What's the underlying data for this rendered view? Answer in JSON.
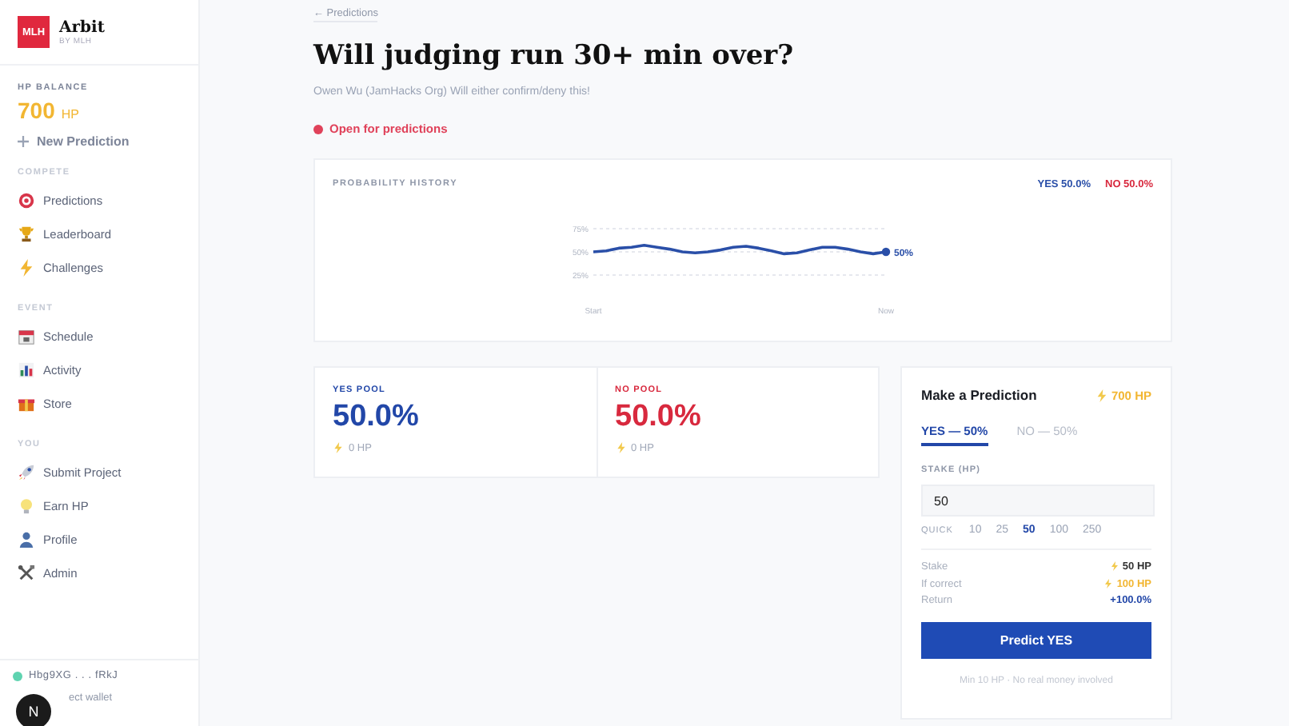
{
  "sidebar": {
    "logo": "MLH",
    "brand": "Arbit",
    "brand_sub": "BY MLH",
    "balance_label": "HP BALANCE",
    "balance_value": "700",
    "balance_unit": "HP",
    "new_prediction": "New Prediction",
    "sections": [
      {
        "title": "COMPETE",
        "items": [
          {
            "label": "Predictions",
            "selected": false
          },
          {
            "label": "Leaderboard",
            "selected": false
          },
          {
            "label": "Challenges",
            "selected": false
          }
        ]
      },
      {
        "title": "EVENT",
        "items": [
          {
            "label": "Schedule",
            "selected": false
          },
          {
            "label": "Activity",
            "selected": false
          },
          {
            "label": "Store",
            "selected": false
          }
        ]
      },
      {
        "title": "YOU",
        "items": [
          {
            "label": "Submit Project",
            "selected": false
          },
          {
            "label": "Earn HP",
            "selected": false
          },
          {
            "label": "Profile",
            "selected": false
          },
          {
            "label": "Admin",
            "selected": false
          }
        ]
      }
    ],
    "wallet": {
      "address": "Hbg9XG . . . fRkJ",
      "connected": true,
      "action": "ect wallet"
    },
    "badge": "N"
  },
  "back_link": "← Predictions",
  "title": "Will judging run 30+ min over?",
  "subtitle": "Owen Wu (JamHacks Org) Will either confirm/deny this!",
  "status": {
    "label": "Open for predictions",
    "color": "#e0425a"
  },
  "history": {
    "title": "PROBABILITY HISTORY",
    "yes": "YES 50.0%",
    "no": "NO 50.0%",
    "end_label": "50%",
    "chart_data": {
      "type": "line",
      "categories": [
        "Start",
        null,
        null,
        null,
        null,
        null,
        null,
        null,
        null,
        null,
        null,
        null,
        null,
        null,
        null,
        null,
        null,
        null,
        null,
        null,
        null,
        null,
        null,
        "Now"
      ],
      "yticks": [
        {
          "value": 25,
          "label": "25%"
        },
        {
          "value": 50,
          "label": "50%"
        },
        {
          "value": 75,
          "label": "75%"
        }
      ],
      "grid": true,
      "ylim": [
        25,
        75
      ],
      "series": [
        {
          "color": "#2a4fa8",
          "values": [
            50,
            51,
            54,
            55,
            57,
            55,
            53,
            50,
            49,
            50,
            52,
            55,
            56,
            54,
            51,
            48,
            49,
            52,
            55,
            55,
            53,
            50,
            48,
            50
          ]
        }
      ]
    }
  },
  "pools": [
    {
      "kind": "yes",
      "label": "YES POOL",
      "value": "50.0%",
      "amount": "0 HP"
    },
    {
      "kind": "no",
      "label": "NO POOL",
      "value": "50.0%",
      "amount": "0 HP"
    }
  ],
  "panel": {
    "title": "Make a Prediction",
    "balance": "700 HP",
    "sides": [
      {
        "label": "YES — 50%",
        "selected": true
      },
      {
        "label": "NO — 50%",
        "selected": false
      }
    ],
    "stake_label": "STAKE (HP)",
    "stake_value": "50",
    "quick_label": "QUICK",
    "quick": [
      {
        "label": "10",
        "selected": false
      },
      {
        "label": "25",
        "selected": false
      },
      {
        "label": "50",
        "selected": true
      },
      {
        "label": "100",
        "selected": false
      },
      {
        "label": "250",
        "selected": false
      }
    ],
    "summary": [
      {
        "kind": "plain",
        "label": "Stake",
        "value": "50 HP"
      },
      {
        "kind": "gold",
        "label": "If correct",
        "value": "100 HP"
      },
      {
        "kind": "blue",
        "label": "Return",
        "value": "+100.0%"
      }
    ],
    "button": "Predict YES",
    "footnote": "Min 10 HP · No real money involved"
  }
}
